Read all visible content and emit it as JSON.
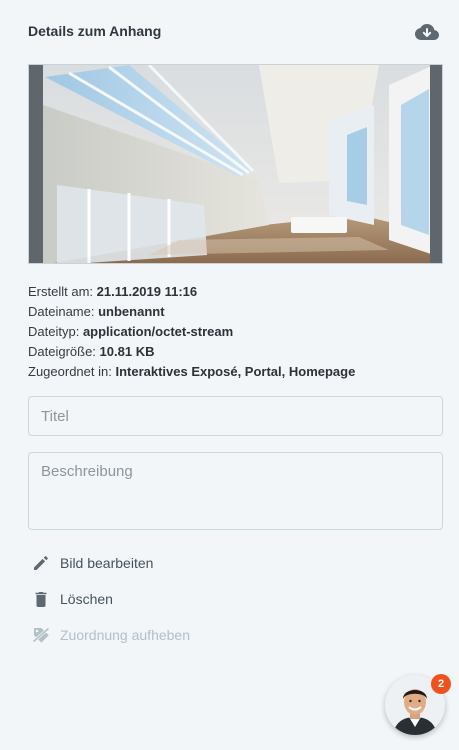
{
  "header": {
    "title": "Details zum Anhang",
    "download_icon": "cloud-download-icon"
  },
  "meta": {
    "created_label": "Erstellt am:",
    "created_value": "21.11.2019 11:16",
    "filename_label": "Dateiname:",
    "filename_value": "unbenannt",
    "filetype_label": "Dateityp:",
    "filetype_value": "application/octet-stream",
    "filesize_label": "Dateigröße:",
    "filesize_value": "10.81 KB",
    "assigned_label": "Zugeordnet in:",
    "assigned_value": "Interaktives Exposé, Portal, Homepage"
  },
  "form": {
    "title_placeholder": "Titel",
    "title_value": "",
    "description_placeholder": "Beschreibung",
    "description_value": ""
  },
  "actions": {
    "edit_label": "Bild bearbeiten",
    "delete_label": "Löschen",
    "unassign_label": "Zuordnung aufheben"
  },
  "chat": {
    "badge_count": "2"
  },
  "colors": {
    "accent_badge": "#f0521e",
    "disabled_text": "#b3c0c8",
    "field_border": "#c9d7df",
    "background": "#f3f6f8"
  }
}
